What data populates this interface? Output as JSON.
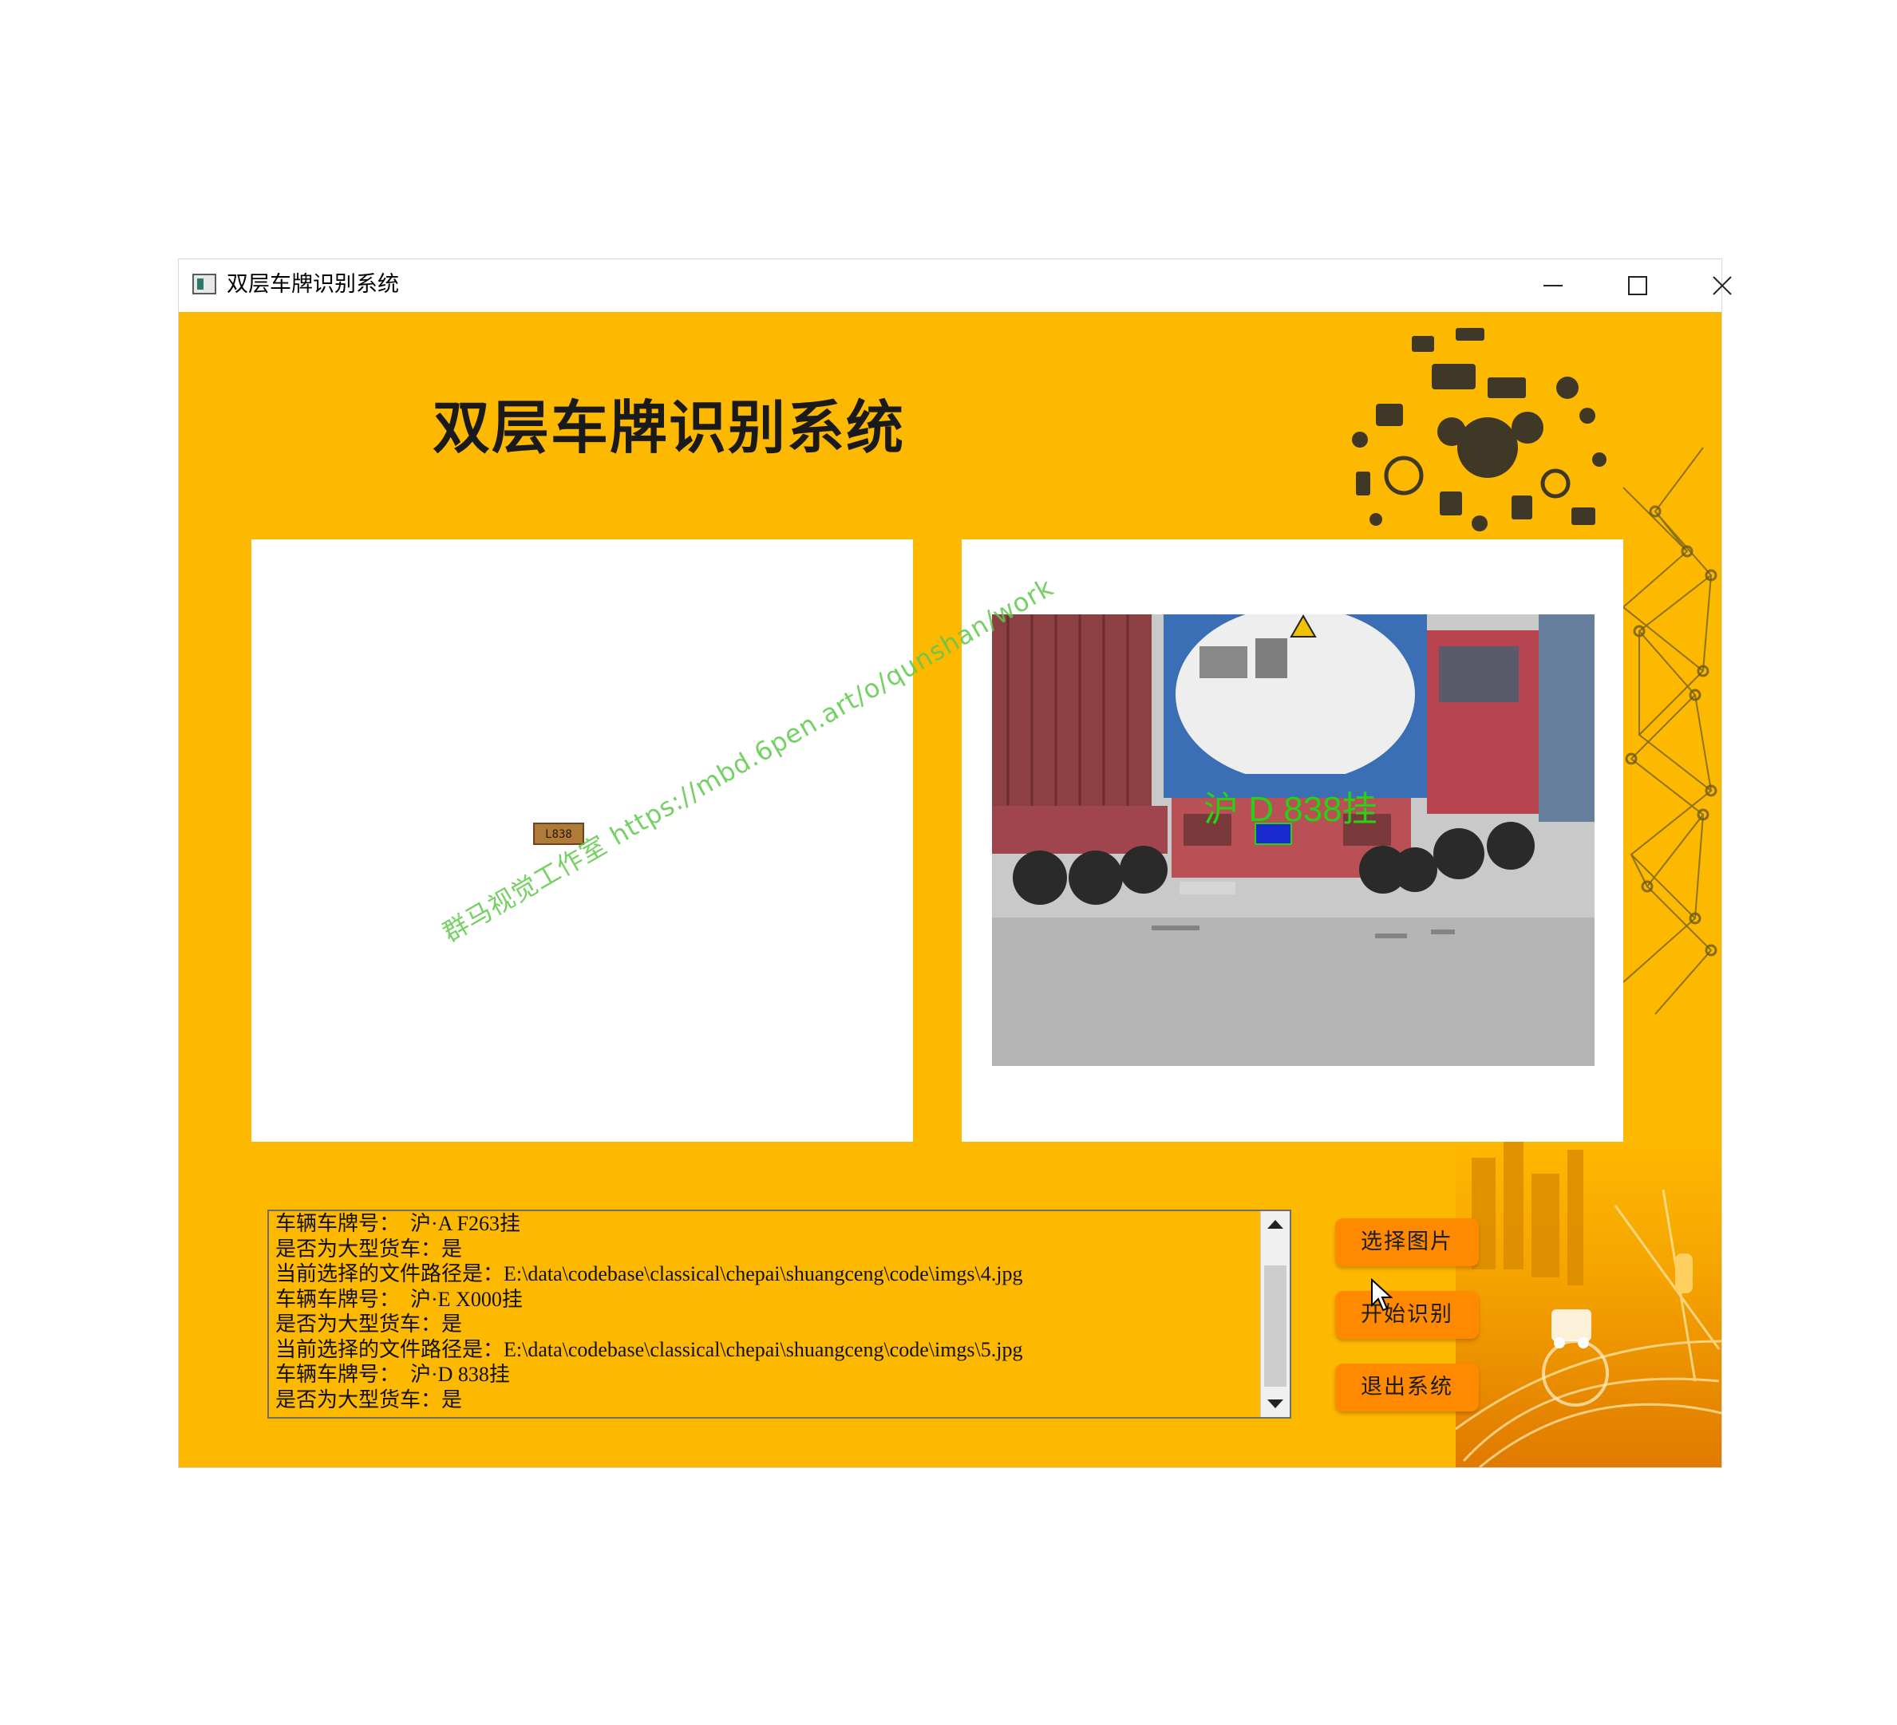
{
  "window": {
    "title": "双层车牌识别系统",
    "controls": [
      "minimize",
      "maximize",
      "close"
    ]
  },
  "header": {
    "title": "双层车牌识别系统"
  },
  "left_panel": {
    "plate_crop_text": "L838"
  },
  "right_panel": {
    "recognized_overlay": "沪 D 838挂"
  },
  "log": {
    "lines": [
      "车辆车牌号：  沪·A F263挂",
      "是否为大型货车：是",
      "当前选择的文件路径是：E:\\data\\codebase\\classical\\chepai\\shuangceng\\code\\imgs\\4.jpg",
      "车辆车牌号：  沪·E X000挂",
      "是否为大型货车：是",
      "当前选择的文件路径是：E:\\data\\codebase\\classical\\chepai\\shuangceng\\code\\imgs\\5.jpg",
      "车辆车牌号：  沪·D 838挂",
      "是否为大型货车：是"
    ]
  },
  "buttons": {
    "select_image": "选择图片",
    "start_recognition": "开始识别",
    "exit_system": "退出系统"
  },
  "watermark": "群马视觉工作室  https://mbd.6pen.art/o/qunshan/work",
  "colors": {
    "background": "#fdb800",
    "button": "#ff8a00",
    "recognized_text": "#28d016"
  }
}
